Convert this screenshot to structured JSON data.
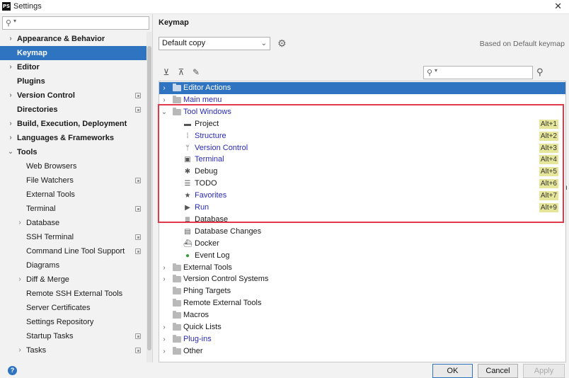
{
  "window": {
    "title": "Settings",
    "close_glyph": "✕",
    "app_icon_text": "PS"
  },
  "sidebar": {
    "search_placeholder": "",
    "items": [
      {
        "label": "Appearance & Behavior",
        "bold": true,
        "arrow": "›",
        "indent": 0,
        "project": false
      },
      {
        "label": "Keymap",
        "bold": true,
        "arrow": "",
        "indent": 0,
        "project": false,
        "selected": true
      },
      {
        "label": "Editor",
        "bold": true,
        "arrow": "›",
        "indent": 0,
        "project": false
      },
      {
        "label": "Plugins",
        "bold": true,
        "arrow": "",
        "indent": 0,
        "project": false
      },
      {
        "label": "Version Control",
        "bold": true,
        "arrow": "›",
        "indent": 0,
        "project": true
      },
      {
        "label": "Directories",
        "bold": true,
        "arrow": "",
        "indent": 0,
        "project": true
      },
      {
        "label": "Build, Execution, Deployment",
        "bold": true,
        "arrow": "›",
        "indent": 0,
        "project": false
      },
      {
        "label": "Languages & Frameworks",
        "bold": true,
        "arrow": "›",
        "indent": 0,
        "project": false
      },
      {
        "label": "Tools",
        "bold": true,
        "arrow": "⌄",
        "indent": 0,
        "project": false
      },
      {
        "label": "Web Browsers",
        "bold": false,
        "arrow": "",
        "indent": 1,
        "project": false
      },
      {
        "label": "File Watchers",
        "bold": false,
        "arrow": "",
        "indent": 1,
        "project": true
      },
      {
        "label": "External Tools",
        "bold": false,
        "arrow": "",
        "indent": 1,
        "project": false
      },
      {
        "label": "Terminal",
        "bold": false,
        "arrow": "",
        "indent": 1,
        "project": true
      },
      {
        "label": "Database",
        "bold": false,
        "arrow": "›",
        "indent": 1,
        "project": false
      },
      {
        "label": "SSH Terminal",
        "bold": false,
        "arrow": "",
        "indent": 1,
        "project": true
      },
      {
        "label": "Command Line Tool Support",
        "bold": false,
        "arrow": "",
        "indent": 1,
        "project": true
      },
      {
        "label": "Diagrams",
        "bold": false,
        "arrow": "",
        "indent": 1,
        "project": false
      },
      {
        "label": "Diff & Merge",
        "bold": false,
        "arrow": "›",
        "indent": 1,
        "project": false
      },
      {
        "label": "Remote SSH External Tools",
        "bold": false,
        "arrow": "",
        "indent": 1,
        "project": false
      },
      {
        "label": "Server Certificates",
        "bold": false,
        "arrow": "",
        "indent": 1,
        "project": false
      },
      {
        "label": "Settings Repository",
        "bold": false,
        "arrow": "",
        "indent": 1,
        "project": false
      },
      {
        "label": "Startup Tasks",
        "bold": false,
        "arrow": "",
        "indent": 1,
        "project": true
      },
      {
        "label": "Tasks",
        "bold": false,
        "arrow": "›",
        "indent": 1,
        "project": true
      }
    ]
  },
  "main": {
    "breadcrumb": "Keymap",
    "scheme_value": "Default copy",
    "based_on": "Based on Default keymap",
    "tree_search_placeholder": "",
    "tree": [
      {
        "label": "Editor Actions",
        "level": 0,
        "arrow": "›",
        "icon": "folder",
        "blue": false,
        "selected": true
      },
      {
        "label": "Main menu",
        "level": 0,
        "arrow": "›",
        "icon": "folder",
        "blue": true
      },
      {
        "label": "Tool Windows",
        "level": 0,
        "arrow": "⌄",
        "icon": "folder",
        "blue": true
      },
      {
        "label": "Project",
        "level": 1,
        "icon": "▬",
        "blue": false,
        "shortcut": "Alt+1"
      },
      {
        "label": "Structure",
        "level": 1,
        "icon": "⁞",
        "blue": true,
        "shortcut": "Alt+2"
      },
      {
        "label": "Version Control",
        "level": 1,
        "icon": "ᛘ",
        "blue": true,
        "shortcut": "Alt+3"
      },
      {
        "label": "Terminal",
        "level": 1,
        "icon": "▣",
        "blue": true,
        "shortcut": "Alt+4"
      },
      {
        "label": "Debug",
        "level": 1,
        "icon": "✱",
        "blue": false,
        "shortcut": "Alt+5"
      },
      {
        "label": "TODO",
        "level": 1,
        "icon": "☰",
        "blue": false,
        "shortcut": "Alt+6"
      },
      {
        "label": "Favorites",
        "level": 1,
        "icon": "★",
        "blue": true,
        "shortcut": "Alt+7"
      },
      {
        "label": "Run",
        "level": 1,
        "icon": "▶",
        "blue": true,
        "shortcut": "Alt+9"
      },
      {
        "label": "Database",
        "level": 1,
        "icon": "≣",
        "blue": false
      },
      {
        "label": "Database Changes",
        "level": 1,
        "icon": "▤",
        "blue": false
      },
      {
        "label": "Docker",
        "level": 1,
        "icon": "⛴",
        "blue": false
      },
      {
        "label": "Event Log",
        "level": 1,
        "icon": "●",
        "blue": false,
        "green": true
      },
      {
        "label": "External Tools",
        "level": 0,
        "arrow": "›",
        "icon": "folder",
        "blue": false
      },
      {
        "label": "Version Control Systems",
        "level": 0,
        "arrow": "›",
        "icon": "folder",
        "blue": false
      },
      {
        "label": "Phing Targets",
        "level": 0,
        "arrow": "",
        "icon": "folder",
        "blue": false
      },
      {
        "label": "Remote External Tools",
        "level": 0,
        "arrow": "",
        "icon": "folder",
        "blue": false
      },
      {
        "label": "Macros",
        "level": 0,
        "arrow": "",
        "icon": "folder",
        "blue": false
      },
      {
        "label": "Quick Lists",
        "level": 0,
        "arrow": "›",
        "icon": "folder",
        "blue": false
      },
      {
        "label": "Plug-ins",
        "level": 0,
        "arrow": "›",
        "icon": "folder",
        "blue": true
      },
      {
        "label": "Other",
        "level": 0,
        "arrow": "›",
        "icon": "folder",
        "blue": false
      }
    ]
  },
  "buttons": {
    "ok": "OK",
    "cancel": "Cancel",
    "apply": "Apply",
    "help": "?"
  },
  "colors": {
    "accent": "#2f74c0",
    "highlight_box": "#e23a4a",
    "shortcut_bg": "#e6e69b",
    "link_blue": "#2a2ab8"
  }
}
